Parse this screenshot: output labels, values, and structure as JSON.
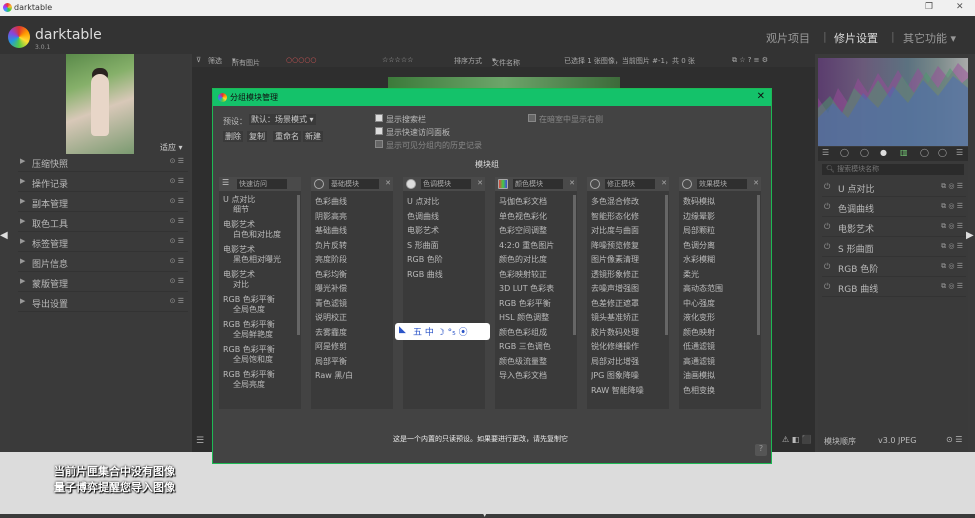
{
  "window": {
    "title": "darktable",
    "btn_restore": "❐",
    "btn_close": "✕"
  },
  "app": {
    "name": "darktable",
    "version": "3.0.1"
  },
  "views": {
    "lighttable": "观片项目",
    "darkroom": "修片设置",
    "other": "其它功能 ▾"
  },
  "toolbar": {
    "filter_label": "筛选",
    "filter_value": "所有图片",
    "sort_label": "排序方式",
    "sort_value": "文件名称",
    "status": "已选择 1 张图像，当前图片 #-1，共 0 张",
    "rating": "☆☆☆☆☆"
  },
  "left": {
    "histogram_btn": "适应",
    "modules": [
      {
        "label": "压缩快照"
      },
      {
        "label": "操作记录"
      },
      {
        "label": "副本管理"
      },
      {
        "label": "取色工具"
      },
      {
        "label": "标签管理"
      },
      {
        "label": "图片信息"
      },
      {
        "label": "蒙版管理"
      },
      {
        "label": "导出设置"
      }
    ]
  },
  "right": {
    "search_placeholder": "搜索模块名称",
    "modules": [
      {
        "label": "U 点对比"
      },
      {
        "label": "色调曲线"
      },
      {
        "label": "电影艺术"
      },
      {
        "label": "S 形曲面"
      },
      {
        "label": "RGB 色阶"
      },
      {
        "label": "RGB 曲线"
      }
    ],
    "bottom_label": "模块顺序",
    "bottom_version": "v3.0 JPEG"
  },
  "overlay": {
    "line1": "当前片匣集合中没有图像",
    "line2": "量子博弈提醒您导入图像"
  },
  "dialog": {
    "title": "分组模块管理",
    "preset_label": "预设：",
    "preset_value": "默认：场景模式",
    "buttons": {
      "delete": "删除",
      "copy": "复制",
      "rename": "重命名",
      "new": "新建"
    },
    "checks": {
      "show_search": "显示搜索栏",
      "show_quick": "显示快速访问面板",
      "auto_fold": "显示可见分组内的历史记录",
      "right_side": "在暗室中显示右侧"
    },
    "group_label": "模块组",
    "footer": "这是一个内置的只读预设。如果要进行更改，请先复制它",
    "help": "?",
    "columns": [
      {
        "name": "快速访问",
        "items": [
          "U 点对比\n细节",
          "电影艺术\n白色和对比度",
          "电影艺术\n黑色相对曝光",
          "电影艺术\n对比",
          "RGB 色彩平衡\n全局色度",
          "RGB 色彩平衡\n全局鲜艳度",
          "RGB 色彩平衡\n全局饱和度",
          "RGB 色彩平衡\n全局亮度"
        ]
      },
      {
        "name": "基础模块",
        "items": [
          "色彩曲线",
          "阴影高亮",
          "基础曲线",
          "负片反转",
          "亮度阶段",
          "色彩均衡",
          "曝光补偿",
          "青色滤镜",
          "说明校正",
          "去雾霾度",
          "阿是修剪",
          "局部平衡",
          "Raw 黑/白"
        ]
      },
      {
        "name": "色调模块",
        "items": [
          "U 点对比",
          "色调曲线",
          "电影艺术",
          "S 形曲面",
          "RGB 色阶",
          "RGB 曲线"
        ]
      },
      {
        "name": "颜色模块",
        "items": [
          "马伽色彩文档",
          "单色视色彩化",
          "色彩空间调整",
          "4:2:0 重色图片",
          "颜色的对比度",
          "色彩映射较正",
          "3D LUT 色彩表",
          "RGB 色彩平衡",
          "HSL 颜色调整",
          "颜色色彩组成",
          "RGB 三色调色",
          "颜色级流量整",
          "导入色彩文档"
        ]
      },
      {
        "name": "修正模块",
        "items": [
          "多色混合修改",
          "智能形态化修",
          "对比度与曲面",
          "降噪预览修复",
          "图片像素清理",
          "透镜形象修正",
          "去噪声增强图",
          "色差修正遮罩",
          "镜头基准矫正",
          "胶片数码处理",
          "锐化修缮操作",
          "局部对比增强",
          "JPG 图象降噪",
          "RAW 智能降噪"
        ]
      },
      {
        "name": "效果模块",
        "items": [
          "数码模拟",
          "边缘晕影",
          "局部颗粒",
          "色调分离",
          "水彩模糊",
          "柔光",
          "高动态范围",
          "中心强度",
          "液化变形",
          "颜色映射",
          "低通滤镜",
          "高通滤镜",
          "油画模拟",
          "色相变换"
        ]
      }
    ]
  },
  "ime": {
    "text": "五 中 ☽ °₅ ⦿"
  }
}
